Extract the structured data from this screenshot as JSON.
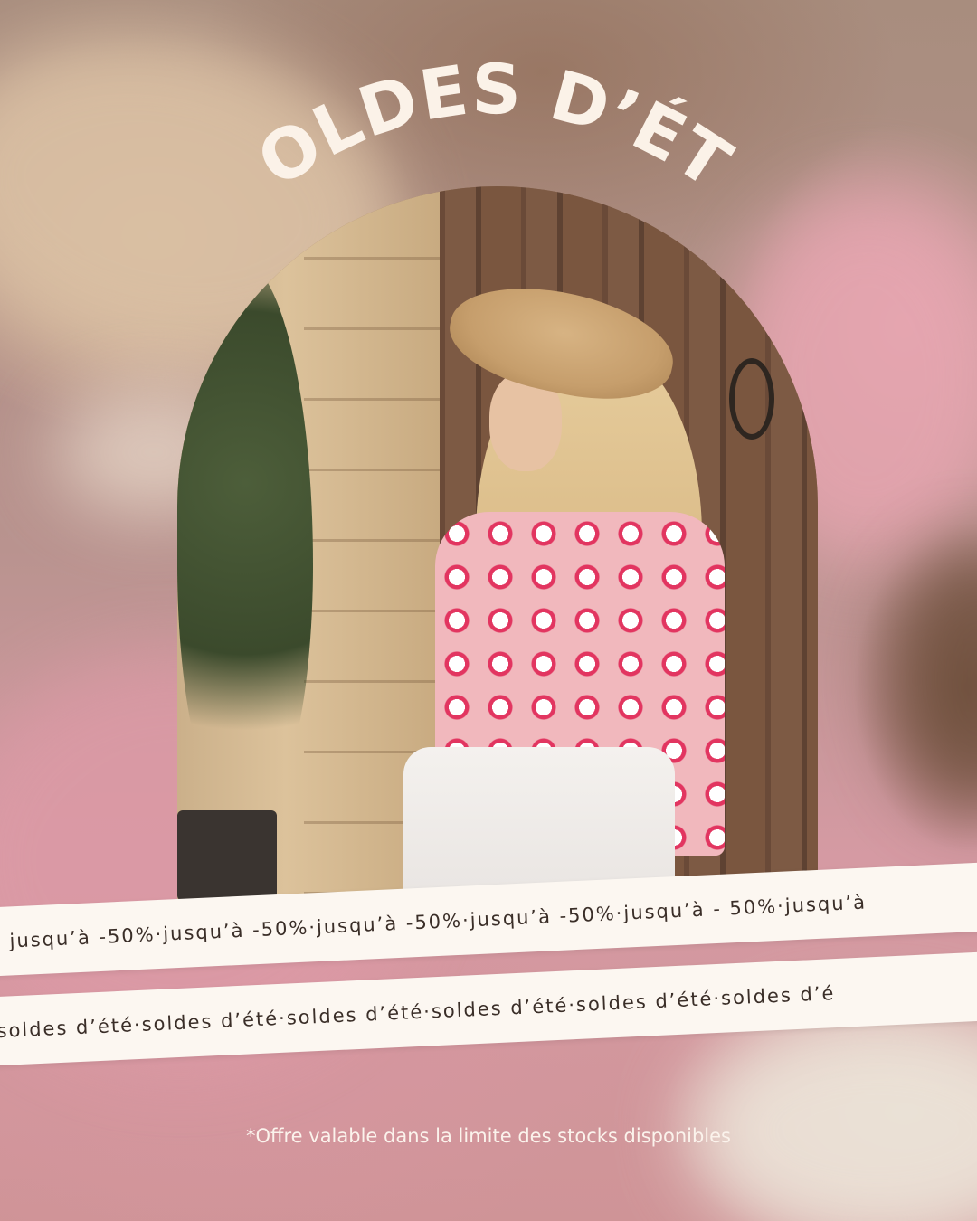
{
  "title": "SOLDES D’ÉTÉ",
  "banner_top": {
    "items": [
      "jusqu’à -50%",
      "jusqu’à -50%",
      "jusqu’à -50%",
      "jusqu’à -50%",
      "jusqu’à - 50%",
      "jusqu’à"
    ],
    "separator": " · "
  },
  "banner_bottom": {
    "items": [
      "soldes d’été",
      "soldes d’été",
      "soldes d’été",
      "soldes d’été",
      "soldes d’été",
      "soldes d’é"
    ],
    "separator": " · "
  },
  "disclaimer": "*Offre valable dans la limite des stocks disponibles",
  "colors": {
    "title": "#fbf2e8",
    "banner_bg": "#fcf7f1",
    "banner_text": "#3a2e28"
  },
  "photo": {
    "icon": "photo-woman-straw-hat"
  }
}
